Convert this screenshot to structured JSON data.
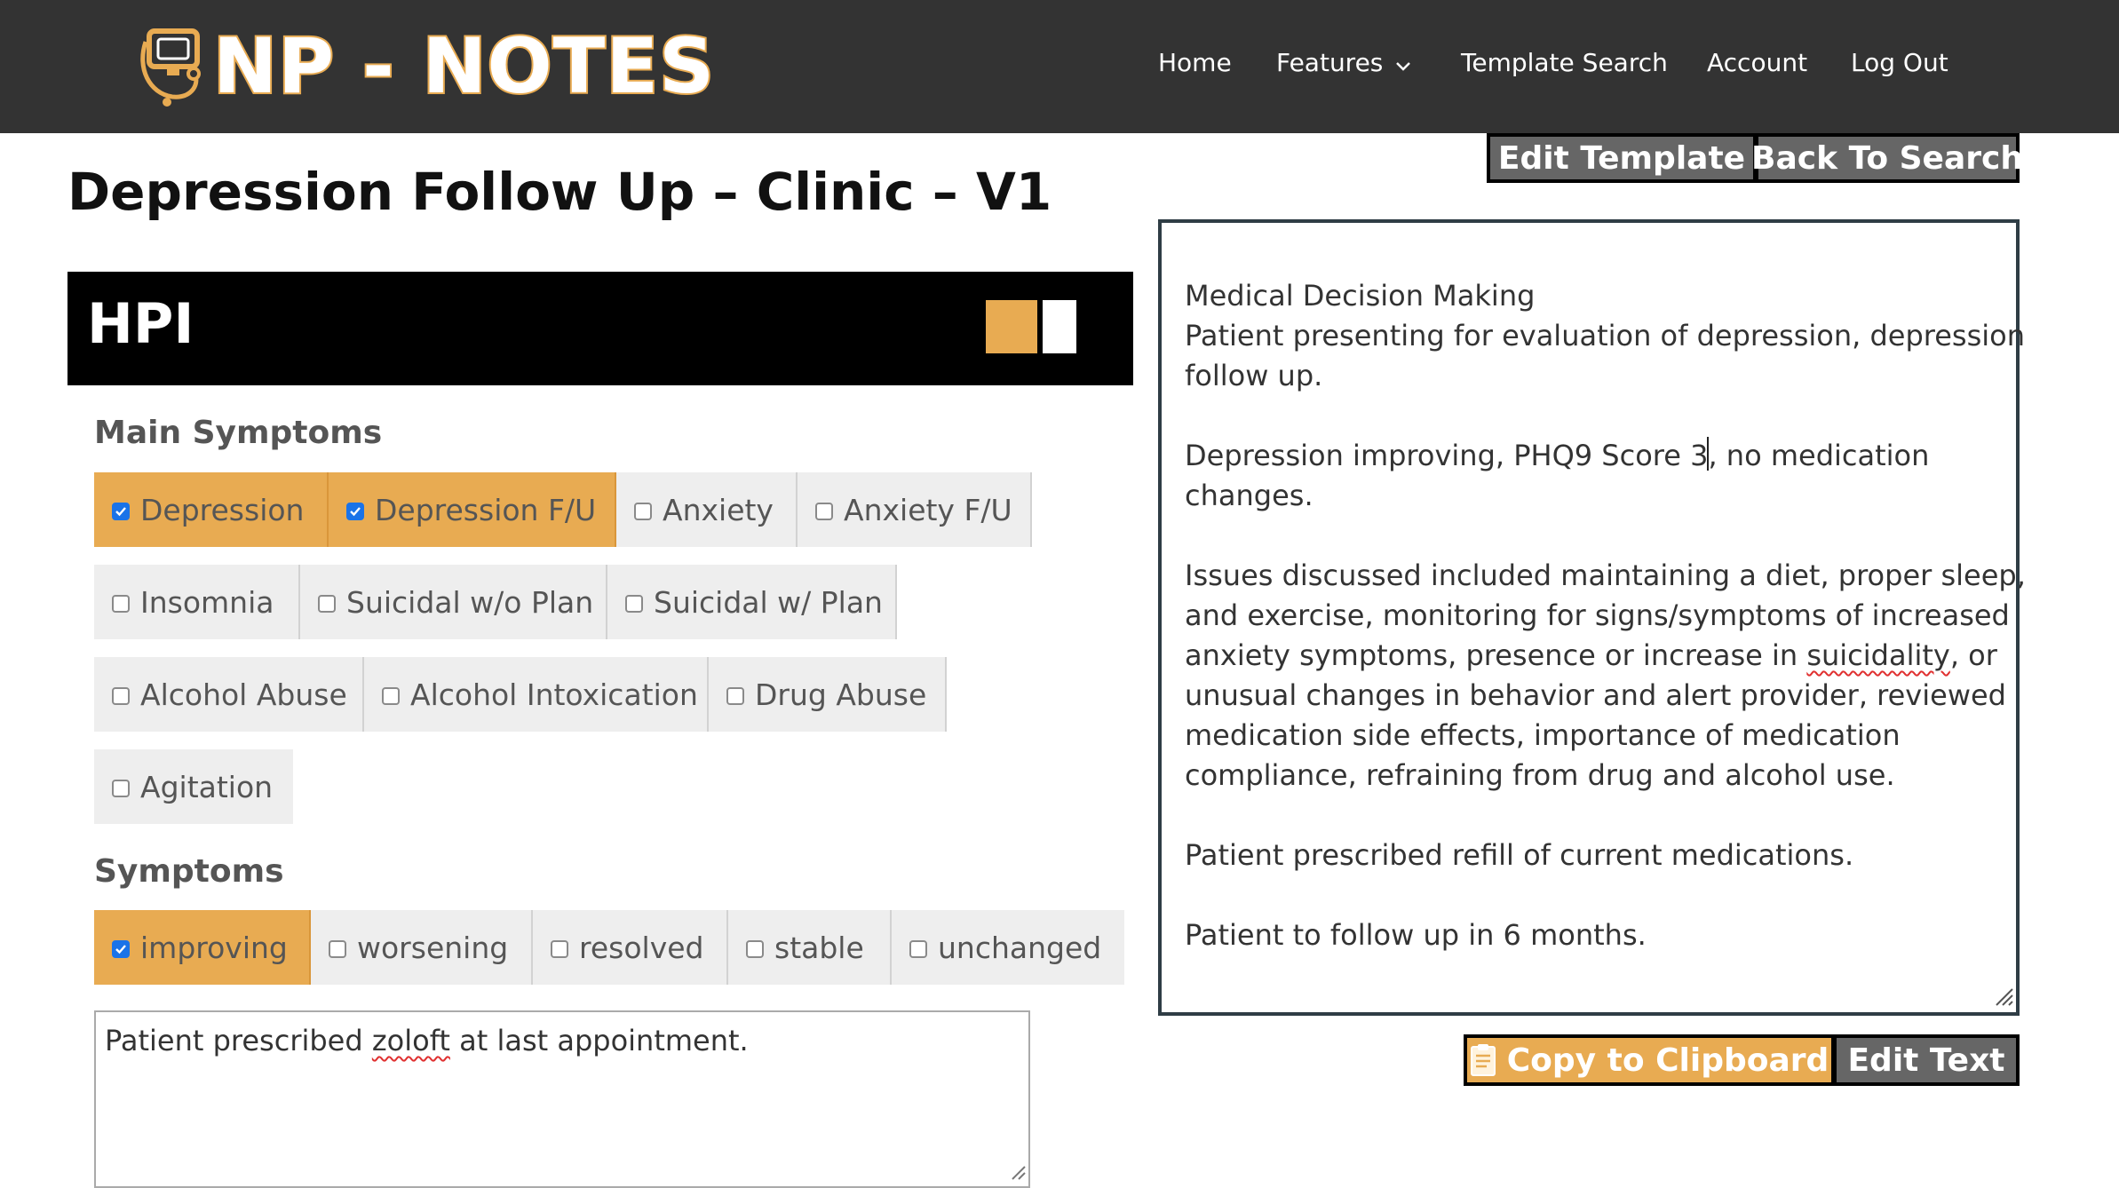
{
  "header": {
    "logo_text": "NP - NOTES",
    "nav": [
      {
        "label": "Home"
      },
      {
        "label": "Features"
      },
      {
        "label": "Template Search"
      },
      {
        "label": "Account"
      },
      {
        "label": "Log Out"
      }
    ]
  },
  "page": {
    "title": "Depression Follow Up – Clinic – V1"
  },
  "hpi": {
    "title": "HPI",
    "main_symptoms": {
      "label": "Main Symptoms",
      "options": [
        {
          "label": "Depression",
          "checked": true
        },
        {
          "label": "Depression F/U",
          "checked": true
        },
        {
          "label": "Anxiety",
          "checked": false
        },
        {
          "label": "Anxiety F/U",
          "checked": false
        },
        {
          "label": "Insomnia",
          "checked": false
        },
        {
          "label": "Suicidal w/o Plan",
          "checked": false
        },
        {
          "label": "Suicidal w/ Plan",
          "checked": false
        },
        {
          "label": "Alcohol Abuse",
          "checked": false
        },
        {
          "label": "Alcohol Intoxication",
          "checked": false
        },
        {
          "label": "Drug Abuse",
          "checked": false
        },
        {
          "label": "Agitation",
          "checked": false
        }
      ]
    },
    "symptoms": {
      "label": "Symptoms",
      "options": [
        {
          "label": "improving",
          "checked": true
        },
        {
          "label": "worsening",
          "checked": false
        },
        {
          "label": "resolved",
          "checked": false
        },
        {
          "label": "stable",
          "checked": false
        },
        {
          "label": "unchanged",
          "checked": false
        }
      ]
    },
    "notes": {
      "before": "Patient prescribed ",
      "misspelled": "zoloft",
      "after": " at last appointment."
    }
  },
  "top_buttons": {
    "edit_template": "Edit Template",
    "back_to_search": "Back To Search"
  },
  "output": {
    "line1": "Medical Decision Making",
    "line2": "Patient presenting for evaluation of depression, depression",
    "line3": "follow up.",
    "line4a": "Depression improving, PHQ9 Score 3",
    "line4b": ", no medication",
    "line5": "changes.",
    "line6": "Issues discussed included maintaining a diet, proper sleep,",
    "line7": "and exercise, monitoring for signs/symptoms of increased",
    "line8a": "anxiety symptoms, presence or increase in ",
    "line8b": "suicidality",
    "line8c": ", or",
    "line9": "unusual changes in behavior and alert provider, reviewed",
    "line10": "medication side effects, importance of medication",
    "line11": "compliance, refraining from drug and alcohol use.",
    "line12": "Patient prescribed refill of current medications.",
    "line13": "Patient to follow up in 6 months."
  },
  "bottom_buttons": {
    "copy": "Copy to Clipboard",
    "edit_text": "Edit Text"
  },
  "colors": {
    "accent": "#e8ab52",
    "topbar": "#333333",
    "checkbox_checked": "#1a73e8"
  },
  "icons": {
    "logo": "stethoscope-computer-icon",
    "features_dropdown": "chevron-down-icon",
    "copy": "clipboard-icon"
  }
}
